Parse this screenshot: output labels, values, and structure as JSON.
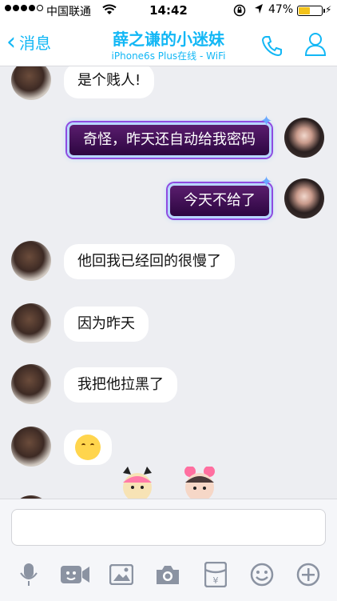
{
  "status_bar": {
    "carrier": "中国联通",
    "time": "14:42",
    "battery_percent": "47%",
    "battery_level": 0.47
  },
  "nav": {
    "back_label": "消息",
    "title": "薛之谦的小迷妹",
    "subtitle": "iPhone6s Plus在线 - WiFi"
  },
  "messages": [
    {
      "side": "left",
      "text": "是个贱人!"
    },
    {
      "side": "right",
      "text": "奇怪，昨天还自动给我密码"
    },
    {
      "side": "right",
      "text": "今天不给了"
    },
    {
      "side": "left",
      "text": "他回我已经回的很慢了"
    },
    {
      "side": "left",
      "text": "因为昨天"
    },
    {
      "side": "left",
      "text": "我把他拉黑了"
    },
    {
      "side": "left",
      "emoji": "yawning-face"
    }
  ],
  "toolbar": [
    "mic-icon",
    "video-icon",
    "image-icon",
    "camera-icon",
    "red-packet-icon",
    "emoji-icon",
    "plus-icon"
  ],
  "colors": {
    "accent": "#12b7f5",
    "sent_bubble": "#3a0b52",
    "received_bubble": "#ffffff",
    "background": "#edeef2"
  }
}
